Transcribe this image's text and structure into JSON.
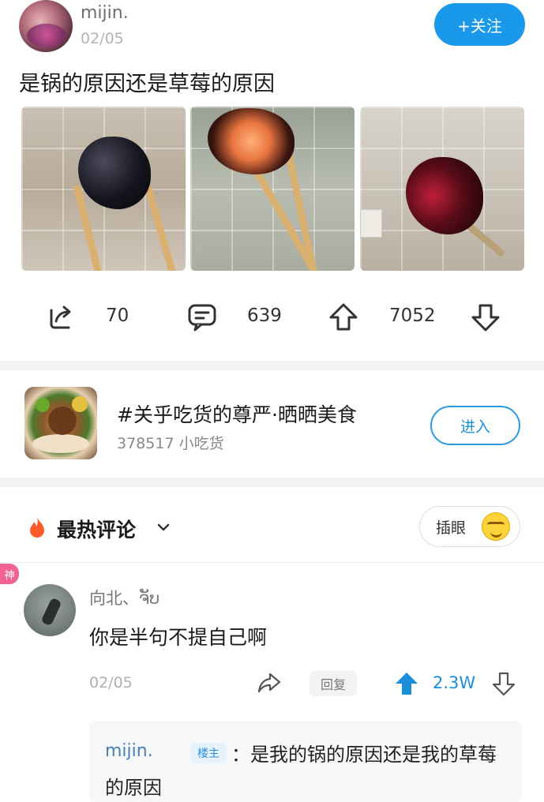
{
  "post": {
    "username": "mijin.",
    "date": "02/05",
    "follow_label": "+关注",
    "title": "是锅的原因还是草莓的原因",
    "actions": {
      "share_count": "70",
      "comment_count": "639",
      "upvote_count": "7052"
    }
  },
  "topic": {
    "title": "#关乎吃货的尊严·晒晒美食",
    "subtitle": "378517 小吃货",
    "enter_label": "进入"
  },
  "comments_header": {
    "title": "最热评论",
    "insert_label": "插眼"
  },
  "comment": {
    "badge": "神",
    "username": "向北、ຈັບ",
    "text": "你是半句不提自己啊",
    "date": "02/05",
    "reply_label": "回复",
    "votes": "2.3W",
    "sub_reply": {
      "username": "mijin.",
      "op_badge": "楼主",
      "text": "：是我的锅的原因还是我的草莓的原因"
    }
  },
  "colors": {
    "accent": "#1a98ea",
    "hot_fire": "#ff5a2a",
    "god_badge": "#f06292"
  }
}
